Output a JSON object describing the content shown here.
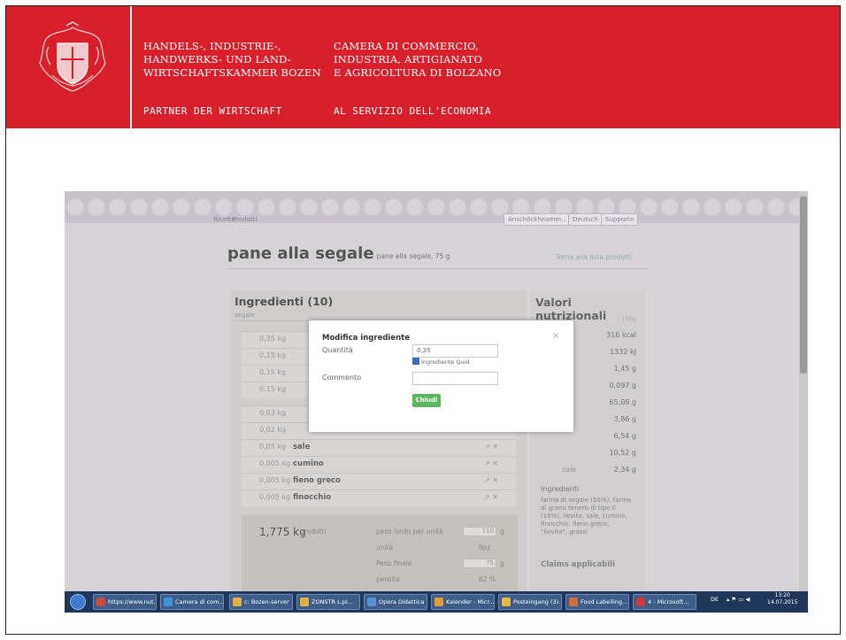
{
  "banner": {
    "de_line1": "HANDELS-, INDUSTRIE-,",
    "de_line2": "HANDWERKS- UND LAND-",
    "de_line3": "WIRTSCHAFTSKAMMER BOZEN",
    "it_line1": "CAMERA DI COMMERCIO,",
    "it_line2": "INDUSTRIA, ARTIGIANATO",
    "it_line3": "E AGRICOLTURA DI BOLZANO",
    "tag_de": "PARTNER DER WIRTSCHAFT",
    "tag_it": "AL SERVIZIO DELL'ECONOMIA",
    "color": "#d8202b"
  },
  "app": {
    "nav_left": [
      "Ricette",
      "Prodotti"
    ],
    "nav_right": [
      "Anschöckheamm... ▾",
      "Deutsch",
      "Supporto"
    ],
    "title": "pane alla segale",
    "subtitle": "pane alla segale, 75 g",
    "back_link": "Torna alla lista prodotti"
  },
  "ingredients": {
    "heading": "Ingredienti (10)",
    "search": "segale",
    "rows": [
      {
        "qty": "0,35 kg",
        "name": ""
      },
      {
        "qty": "0,15 kg",
        "name": ""
      },
      {
        "qty": "0,15 kg",
        "name": ""
      },
      {
        "qty": "0,15 kg",
        "name": ""
      },
      {
        "qty": "0,03 kg",
        "name": ""
      },
      {
        "qty": "0,02 kg",
        "name": ""
      },
      {
        "qty": "0,05 kg",
        "name": "sale"
      },
      {
        "qty": "0,005 kg",
        "name": "cumino"
      },
      {
        "qty": "0,005 kg",
        "name": "fieno greco"
      },
      {
        "qty": "0,005 kg",
        "name": "finocchio"
      }
    ],
    "total": "1,775 kg",
    "footer": {
      "label1": "prodotti",
      "label2": "peso lordo per unità",
      "value2": "110",
      "unit2": "g",
      "label3": "unità",
      "value3": "9pz",
      "label4": "Peso finale",
      "value4": "75",
      "unit4": "g",
      "label5": "perdita",
      "value5": "62 %"
    }
  },
  "nutrition": {
    "heading": "Valori nutrizionali",
    "per": "100g",
    "values": [
      "316 kcal",
      "1332 kJ",
      "1,45 g",
      "0,097 g",
      "65,08 g",
      "3,86 g",
      "6,54 g",
      "10,52 g",
      "2,34 g"
    ],
    "labels": [
      "",
      "",
      "",
      "",
      "",
      "",
      "",
      "",
      "sale"
    ],
    "ing_heading": "Ingredienti",
    "ing_text": "farina di segale (50%), farina di grano tenero di tipo 0 (18%), lievito, sale, cumino, finocchio, fieno greco, \"lievito\", grassi",
    "claims": "Claims applicabili"
  },
  "modal": {
    "title": "Modifica ingrediente",
    "close": "×",
    "qty_label": "Quantità",
    "qty_value": "0,35",
    "checkbox_label": "Ingrediente Quid",
    "comment_label": "Commento",
    "comment_value": "",
    "button": "Chiudi"
  },
  "taskbar": {
    "items": [
      {
        "label": "https://www.nut...",
        "color": "#d04a3a"
      },
      {
        "label": "Camera di com...",
        "color": "#3d8fd6"
      },
      {
        "label": "c: Bozen-server",
        "color": "#e0b040"
      },
      {
        "label": "ZONSTR L:pi...",
        "color": "#e0b040"
      },
      {
        "label": "Opera Didattica",
        "color": "#5a8fd6"
      },
      {
        "label": "Kalender - Micr...",
        "color": "#e0a030"
      },
      {
        "label": "Posteingang (3)...",
        "color": "#e8b83a"
      },
      {
        "label": "Food Labelling...",
        "color": "#d06a3a"
      },
      {
        "label": "4 - Microsoft...",
        "color": "#c83a3a"
      }
    ],
    "lang": "DE",
    "time": "13:20",
    "date": "14.07.2015"
  }
}
